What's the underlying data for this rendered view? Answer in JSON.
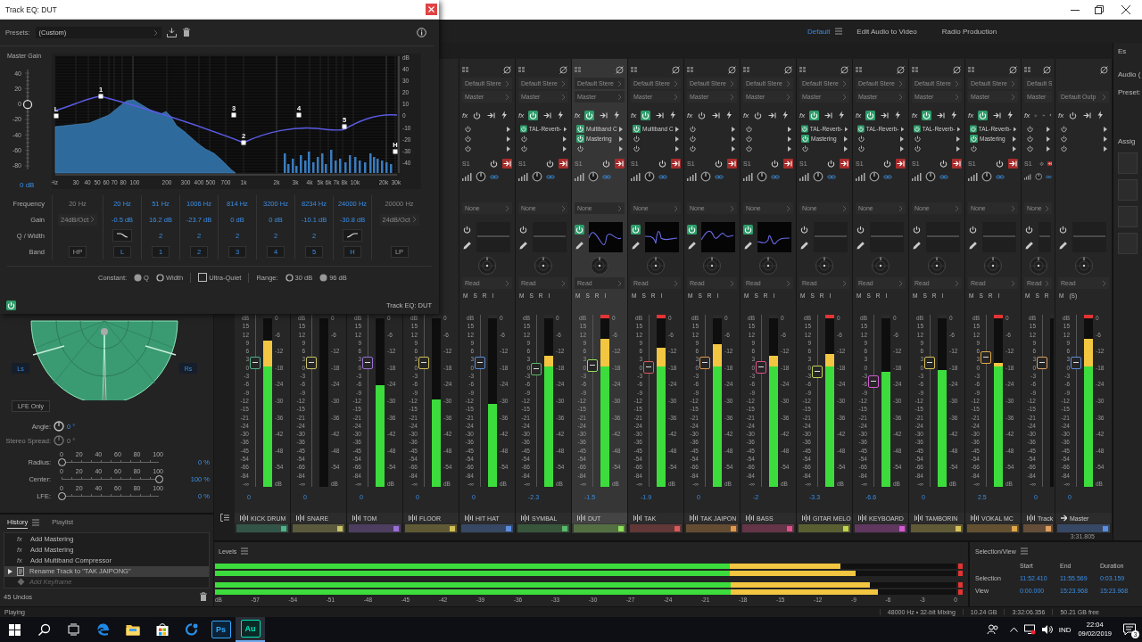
{
  "workspaces": [
    {
      "label": "Default",
      "selected": true
    },
    {
      "label": "Edit Audio to Video",
      "selected": false
    },
    {
      "label": "Radio Production",
      "selected": false
    }
  ],
  "eq_window": {
    "title": "Track EQ: DUT",
    "presets_label": "Presets:",
    "preset": "(Custom)",
    "master_gain": {
      "label": "Master Gain",
      "ticks": [
        "40",
        "20",
        "0",
        "-20",
        "-40",
        "-60",
        "-80"
      ],
      "level": 0.65,
      "reading": "0 dB"
    },
    "graph": {
      "db_ticks": [
        "dB",
        "40",
        "30",
        "20",
        "10",
        "0",
        "-10",
        "-20",
        "-30",
        "-40"
      ],
      "freq_ticks": [
        "Hz",
        "30",
        "40",
        "50",
        "60",
        "70",
        "80",
        "100",
        "200",
        "300",
        "400",
        "500",
        "700",
        "1k",
        "2k",
        "3k",
        "4k",
        "5k",
        "6k",
        "7k",
        "8k",
        "10k",
        "20k",
        "30k"
      ]
    },
    "row_labels": [
      "Frequency",
      "Gain",
      "Q / Width",
      "Band"
    ],
    "bands": [
      {
        "kind": "filter",
        "enabled": false,
        "frequency": "20 Hz",
        "slope": "24dB/Oct",
        "band": "HP"
      },
      {
        "kind": "low_shelf",
        "enabled": true,
        "frequency": "20 Hz",
        "gain": "-0.5 dB",
        "band": "L",
        "marker": "L"
      },
      {
        "kind": "peak",
        "enabled": true,
        "frequency": "51 Hz",
        "gain": "16.2 dB",
        "q": "2",
        "band": "1",
        "marker": "1"
      },
      {
        "kind": "peak",
        "enabled": true,
        "frequency": "1006 Hz",
        "gain": "-23.7 dB",
        "q": "2",
        "band": "2",
        "marker": "2"
      },
      {
        "kind": "peak",
        "enabled": true,
        "frequency": "814 Hz",
        "gain": "0 dB",
        "q": "2",
        "band": "3",
        "marker": "3"
      },
      {
        "kind": "peak",
        "enabled": true,
        "frequency": "3200 Hz",
        "gain": "0 dB",
        "q": "2",
        "band": "4",
        "marker": "4"
      },
      {
        "kind": "peak",
        "enabled": true,
        "frequency": "8234 Hz",
        "gain": "-10.1 dB",
        "q": "2",
        "band": "5",
        "marker": "5"
      },
      {
        "kind": "high_shelf",
        "enabled": true,
        "frequency": "24000 Hz",
        "gain": "-30.8 dB",
        "band": "H",
        "marker": "H"
      },
      {
        "kind": "filter",
        "enabled": false,
        "frequency": "20000 Hz",
        "slope": "24dB/Oct",
        "band": "LP"
      }
    ],
    "constant_label": "Constant:",
    "constant_options": [
      {
        "label": "Q",
        "selected": true
      },
      {
        "label": "Width",
        "selected": false
      }
    ],
    "ultra_quiet": {
      "label": "Ultra-Quiet",
      "checked": false
    },
    "range_label": "Range:",
    "range_options": [
      {
        "label": "30 dB",
        "selected": false
      },
      {
        "label": "96 dB",
        "selected": true
      }
    ],
    "power_on": true,
    "footer_title": "Track EQ: DUT"
  },
  "panner": {
    "left_label": "Ls",
    "right_label": "Rs",
    "lfe_button": "LFE Only",
    "knobs": [
      {
        "label": "Angle:",
        "reading": "0 °",
        "disabled": false
      },
      {
        "label": "Stereo Spread:",
        "reading": "0 °",
        "disabled": true
      }
    ],
    "sliders": [
      {
        "label": "Radius:",
        "ticks": [
          "0",
          "20",
          "40",
          "60",
          "80",
          "100"
        ],
        "level": 0,
        "reading": "0 %"
      },
      {
        "label": "Center:",
        "ticks": [
          "0",
          "20",
          "40",
          "60",
          "80",
          "100"
        ],
        "level": 1,
        "reading": "100 %"
      },
      {
        "label": "LFE:",
        "ticks": [
          "0",
          "20",
          "40",
          "60",
          "80",
          "100"
        ],
        "level": 0,
        "reading": "0 %"
      }
    ]
  },
  "history": {
    "tabs": [
      {
        "label": "History",
        "selected": true
      },
      {
        "label": "Playlist",
        "selected": false
      }
    ],
    "items": [
      {
        "kind": "effect",
        "icon_text": "fx",
        "text": "Add Mastering",
        "selected": false,
        "undone": false
      },
      {
        "kind": "effect",
        "icon_text": "fx",
        "text": "Add Mastering",
        "selected": false,
        "undone": false
      },
      {
        "kind": "effect",
        "icon_text": "fx",
        "text": "Add Multiband Compressor",
        "selected": false,
        "undone": false
      },
      {
        "kind": "rename",
        "text": "Rename Track to \"TAK JAIPONG\"",
        "selected": true,
        "undone": false
      },
      {
        "kind": "keyframe",
        "text": "Add Keyframe",
        "selected": false,
        "undone": true
      }
    ],
    "undos": "45 Undos"
  },
  "mixer": {
    "channels": [
      {
        "name": "KICK DRUM",
        "color": "#4fb38a",
        "selected": false,
        "fader": {
          "level": 0.74,
          "reading": "0"
        },
        "meter": {
          "level": 0.85,
          "clip": false
        },
        "fader_scale": [
          "dB",
          "15",
          "12",
          "9",
          "6",
          "3",
          "0",
          "-3",
          "-6",
          "-9",
          "-12",
          "-15",
          "-21",
          "-24",
          "-30",
          "-36",
          "-45",
          "-54",
          "-66",
          "-84",
          "-∞"
        ],
        "meter_scale": [
          "0",
          "-6",
          "-12",
          "-18",
          "-24",
          "-30",
          "-36",
          "-42",
          "-48",
          "-54",
          "dB"
        ]
      },
      {
        "name": "SNARE",
        "color": "#c9c46a",
        "selected": false,
        "fader": {
          "level": 0.74,
          "reading": "0"
        },
        "meter": {
          "level": 0,
          "clip": false
        },
        "fader_scale": [
          "dB",
          "15",
          "12",
          "9",
          "6",
          "3",
          "0",
          "-3",
          "-6",
          "-9",
          "-12",
          "-15",
          "-21",
          "-24",
          "-30",
          "-36",
          "-45",
          "-54",
          "-66",
          "-84",
          "-∞"
        ],
        "meter_scale": [
          "0",
          "-6",
          "-12",
          "-18",
          "-24",
          "-30",
          "-36",
          "-42",
          "-48",
          "-54",
          "dB"
        ]
      },
      {
        "name": "TOM",
        "color": "#9b6fd6",
        "selected": false,
        "fader": {
          "level": 0.74,
          "reading": "0"
        },
        "meter": {
          "level": 0.59,
          "clip": false
        },
        "fader_scale": [
          "dB",
          "15",
          "12",
          "9",
          "6",
          "3",
          "0",
          "-3",
          "-6",
          "-9",
          "-12",
          "-15",
          "-21",
          "-24",
          "-30",
          "-36",
          "-45",
          "-54",
          "-66",
          "-84",
          "-∞"
        ],
        "meter_scale": [
          "0",
          "-6",
          "-12",
          "-18",
          "-24",
          "-30",
          "-36",
          "-42",
          "-48",
          "-54",
          "dB"
        ]
      },
      {
        "name": "FLOOR",
        "color": "#d2bf55",
        "selected": false,
        "fader": {
          "level": 0.74,
          "reading": "0"
        },
        "meter": {
          "level": 0.51,
          "clip": false
        },
        "fader_scale": [
          "dB",
          "15",
          "12",
          "9",
          "6",
          "3",
          "0",
          "-3",
          "-6",
          "-9",
          "-12",
          "-15",
          "-21",
          "-24",
          "-30",
          "-36",
          "-45",
          "-54",
          "-66",
          "-84",
          "-∞"
        ],
        "meter_scale": [
          "0",
          "-6",
          "-12",
          "-18",
          "-24",
          "-30",
          "-36",
          "-42",
          "-48",
          "-54",
          "dB"
        ]
      },
      {
        "name": "HIT HAT",
        "color": "#5b8ee0",
        "selected": false,
        "fader": {
          "level": 0.74,
          "reading": "0"
        },
        "meter": {
          "level": 0.48,
          "clip": false
        },
        "fader_scale": [
          "dB",
          "15",
          "12",
          "9",
          "6",
          "3",
          "0",
          "-3",
          "-6",
          "-9",
          "-12",
          "-15",
          "-21",
          "-24",
          "-30",
          "-36",
          "-45",
          "-54",
          "-66",
          "-84",
          "-∞"
        ],
        "meter_scale": [
          "0",
          "-6",
          "-12",
          "-18",
          "-24",
          "-30",
          "-36",
          "-42",
          "-48",
          "-54",
          "dB"
        ],
        "strip": {
          "input": "Default Stere",
          "output": "Master",
          "fx_label": "fx",
          "fx_on": false,
          "inserts": [
            {
              "on": false
            },
            {
              "on": false
            },
            {
              "on": false
            }
          ],
          "send": "S1",
          "bus": "None",
          "eq_on": false,
          "automation": "Read",
          "msr": [
            "M",
            "S",
            "R",
            "I"
          ]
        }
      },
      {
        "name": "SYMBAL",
        "color": "#59b86a",
        "selected": false,
        "fader": {
          "level": 0.7,
          "reading": "-2.3"
        },
        "meter": {
          "level": 0.76,
          "clip": false
        },
        "fader_scale": [
          "dB",
          "15",
          "12",
          "9",
          "6",
          "3",
          "0",
          "-3",
          "-6",
          "-9",
          "-12",
          "-15",
          "-21",
          "-24",
          "-30",
          "-36",
          "-45",
          "-54",
          "-66",
          "-84",
          "-∞"
        ],
        "meter_scale": [
          "0",
          "-6",
          "-12",
          "-18",
          "-24",
          "-30",
          "-36",
          "-42",
          "-48",
          "-54",
          "dB"
        ],
        "strip": {
          "input": "Default Stere",
          "output": "Master",
          "fx_label": "fx",
          "fx_on": true,
          "inserts": [
            {
              "name": "TAL-Reverb-",
              "on": true
            },
            {
              "on": false
            },
            {
              "on": false
            }
          ],
          "send": "S1",
          "bus": "None",
          "eq_on": false,
          "automation": "Read",
          "msr": [
            "M",
            "S",
            "R",
            "I"
          ]
        }
      },
      {
        "name": "DUT",
        "color": "#8fe05a",
        "selected": true,
        "fader": {
          "level": 0.72,
          "reading": "-1.5"
        },
        "meter": {
          "level": 0.86,
          "clip": true
        },
        "fader_scale": [
          "dB",
          "15",
          "12",
          "9",
          "6",
          "3",
          "0",
          "-3",
          "-6",
          "-9",
          "-12",
          "-15",
          "-21",
          "-24",
          "-30",
          "-36",
          "-45",
          "-54",
          "-66",
          "-84",
          "-∞"
        ],
        "meter_scale": [
          "0",
          "-6",
          "-12",
          "-18",
          "-24",
          "-30",
          "-36",
          "-42",
          "-48",
          "-54",
          "dB"
        ],
        "strip": {
          "input": "Default Stere",
          "output": "Master",
          "fx_label": "fx",
          "fx_on": true,
          "inserts": [
            {
              "name": "Multiband C",
              "on": true
            },
            {
              "name": "Mastering",
              "on": true
            },
            {
              "on": false
            }
          ],
          "send": "S1",
          "bus": "None",
          "eq_on": true,
          "automation": "Read",
          "msr": [
            "M",
            "S",
            "R",
            "I"
          ]
        }
      },
      {
        "name": "TAK",
        "color": "#d85a5a",
        "selected": false,
        "fader": {
          "level": 0.71,
          "reading": "-1.9"
        },
        "meter": {
          "level": 0.81,
          "clip": true
        },
        "fader_scale": [
          "dB",
          "15",
          "12",
          "9",
          "6",
          "3",
          "0",
          "-3",
          "-6",
          "-9",
          "-12",
          "-15",
          "-21",
          "-24",
          "-30",
          "-36",
          "-45",
          "-54",
          "-66",
          "-84",
          "-∞"
        ],
        "meter_scale": [
          "0",
          "-6",
          "-12",
          "-18",
          "-24",
          "-30",
          "-36",
          "-42",
          "-48",
          "-54",
          "dB"
        ],
        "strip": {
          "input": "Default Stere",
          "output": "Master",
          "fx_label": "fx",
          "fx_on": true,
          "inserts": [
            {
              "name": "Multiband C",
              "on": true
            },
            {
              "on": false
            },
            {
              "on": false
            }
          ],
          "send": "S1",
          "bus": "None",
          "eq_on": true,
          "automation": "Read",
          "msr": [
            "M",
            "S",
            "R",
            "I"
          ]
        }
      },
      {
        "name": "TAK JAIPON",
        "color": "#e09a4a",
        "selected": false,
        "fader": {
          "level": 0.74,
          "reading": "0"
        },
        "meter": {
          "level": 0.83,
          "clip": false
        },
        "fader_scale": [
          "dB",
          "15",
          "12",
          "9",
          "6",
          "3",
          "0",
          "-3",
          "-6",
          "-9",
          "-12",
          "-15",
          "-21",
          "-24",
          "-30",
          "-36",
          "-45",
          "-54",
          "-66",
          "-84",
          "-∞"
        ],
        "meter_scale": [
          "0",
          "-6",
          "-12",
          "-18",
          "-24",
          "-30",
          "-36",
          "-42",
          "-48",
          "-54",
          "dB"
        ],
        "strip": {
          "input": "Default Stere",
          "output": "Master",
          "fx_label": "fx",
          "fx_on": false,
          "inserts": [
            {
              "on": false
            },
            {
              "on": false
            },
            {
              "on": false
            }
          ],
          "send": "S1",
          "bus": "None",
          "eq_on": true,
          "automation": "Read",
          "msr": [
            "M",
            "S",
            "R",
            "I"
          ]
        }
      },
      {
        "name": "BASS",
        "color": "#e0508a",
        "selected": false,
        "fader": {
          "level": 0.71,
          "reading": "-2"
        },
        "meter": {
          "level": 0.76,
          "clip": false
        },
        "fader_scale": [
          "dB",
          "15",
          "12",
          "9",
          "6",
          "3",
          "0",
          "-3",
          "-6",
          "-9",
          "-12",
          "-15",
          "-21",
          "-24",
          "-30",
          "-36",
          "-45",
          "-54",
          "-66",
          "-84",
          "-∞"
        ],
        "meter_scale": [
          "0",
          "-6",
          "-12",
          "-18",
          "-24",
          "-30",
          "-36",
          "-42",
          "-48",
          "-54",
          "dB"
        ],
        "strip": {
          "input": "Default Stere",
          "output": "Master",
          "fx_label": "fx",
          "fx_on": false,
          "inserts": [
            {
              "on": false
            },
            {
              "on": false
            },
            {
              "on": false
            }
          ],
          "send": "S1",
          "bus": "None",
          "eq_on": true,
          "automation": "Read",
          "msr": [
            "M",
            "S",
            "R",
            "I"
          ]
        }
      },
      {
        "name": "GITAR MELO",
        "color": "#c2d34a",
        "selected": false,
        "fader": {
          "level": 0.68,
          "reading": "-3.3"
        },
        "meter": {
          "level": 0.77,
          "clip": true
        },
        "fader_scale": [
          "dB",
          "15",
          "12",
          "9",
          "6",
          "3",
          "0",
          "-3",
          "-6",
          "-9",
          "-12",
          "-15",
          "-21",
          "-24",
          "-30",
          "-36",
          "-45",
          "-54",
          "-66",
          "-84",
          "-∞"
        ],
        "meter_scale": [
          "0",
          "-6",
          "-12",
          "-18",
          "-24",
          "-30",
          "-36",
          "-42",
          "-48",
          "-54",
          "dB"
        ],
        "strip": {
          "input": "Default Stere",
          "output": "Master",
          "fx_label": "fx",
          "fx_on": true,
          "inserts": [
            {
              "name": "TAL-Reverb-",
              "on": true
            },
            {
              "name": "Mastering",
              "on": true
            },
            {
              "on": false
            }
          ],
          "send": "S1",
          "bus": "None",
          "eq_on": false,
          "automation": "Read",
          "msr": [
            "M",
            "S",
            "R",
            "I"
          ]
        }
      },
      {
        "name": "KEYBOARD",
        "color": "#d35ad3",
        "selected": false,
        "fader": {
          "level": 0.62,
          "reading": "-6.6"
        },
        "meter": {
          "level": 0.67,
          "clip": false
        },
        "fader_scale": [
          "dB",
          "15",
          "12",
          "9",
          "6",
          "3",
          "0",
          "-3",
          "-6",
          "-9",
          "-12",
          "-15",
          "-21",
          "-24",
          "-30",
          "-36",
          "-45",
          "-54",
          "-66",
          "-84",
          "-∞"
        ],
        "meter_scale": [
          "0",
          "-6",
          "-12",
          "-18",
          "-24",
          "-30",
          "-36",
          "-42",
          "-48",
          "-54",
          "dB"
        ],
        "strip": {
          "input": "Default Stere",
          "output": "Master",
          "fx_label": "fx",
          "fx_on": true,
          "inserts": [
            {
              "name": "TAL-Reverb-",
              "on": true
            },
            {
              "on": false
            },
            {
              "on": false
            }
          ],
          "send": "S1",
          "bus": "None",
          "eq_on": false,
          "automation": "Read",
          "msr": [
            "M",
            "S",
            "R",
            "I"
          ]
        }
      },
      {
        "name": "TAMBORIN",
        "color": "#d8c25a",
        "selected": false,
        "fader": {
          "level": 0.74,
          "reading": "0"
        },
        "meter": {
          "level": 0.68,
          "clip": false
        },
        "fader_scale": [
          "dB",
          "15",
          "12",
          "9",
          "6",
          "3",
          "0",
          "-3",
          "-6",
          "-9",
          "-12",
          "-15",
          "-21",
          "-24",
          "-30",
          "-36",
          "-45",
          "-54",
          "-66",
          "-84",
          "-∞"
        ],
        "meter_scale": [
          "0",
          "-6",
          "-12",
          "-18",
          "-24",
          "-30",
          "-36",
          "-42",
          "-48",
          "-54",
          "dB"
        ],
        "strip": {
          "input": "Default Stere",
          "output": "Master",
          "fx_label": "fx",
          "fx_on": true,
          "inserts": [
            {
              "name": "TAL-Reverb-",
              "on": true
            },
            {
              "on": false
            },
            {
              "on": false
            }
          ],
          "send": "S1",
          "bus": "None",
          "eq_on": false,
          "automation": "Read",
          "msr": [
            "M",
            "S",
            "R",
            "I"
          ]
        }
      },
      {
        "name": "VOKAL MC",
        "color": "#e0a84a",
        "selected": false,
        "fader": {
          "level": 0.77,
          "reading": "2.5"
        },
        "meter": {
          "level": 0.72,
          "clip": true
        },
        "fader_scale": [
          "dB",
          "15",
          "12",
          "9",
          "6",
          "3",
          "0",
          "-3",
          "-6",
          "-9",
          "-12",
          "-15",
          "-21",
          "-24",
          "-30",
          "-36",
          "-45",
          "-54",
          "-66",
          "-84",
          "-∞"
        ],
        "meter_scale": [
          "0",
          "-6",
          "-12",
          "-18",
          "-24",
          "-30",
          "-36",
          "-42",
          "-48",
          "-54",
          "dB"
        ],
        "strip": {
          "input": "Default Stere",
          "output": "Master",
          "fx_label": "fx",
          "fx_on": true,
          "inserts": [
            {
              "name": "TAL-Reverb-",
              "on": true
            },
            {
              "name": "Mastering",
              "on": true
            },
            {
              "on": false
            }
          ],
          "send": "S1",
          "bus": "None",
          "eq_on": false,
          "automation": "Read",
          "msr": [
            "M",
            "S",
            "R",
            "I"
          ]
        }
      },
      {
        "name": "Track",
        "color": "#e0a060",
        "selected": false,
        "fader": {
          "level": 0.74,
          "reading": "0"
        },
        "meter": {
          "level": 0,
          "clip": false
        },
        "fader_scale": [
          "dB",
          "15",
          "12",
          "9",
          "6",
          "3",
          "0",
          "-3",
          "-6",
          "-9",
          "-12",
          "-15",
          "-21",
          "-24",
          "-30",
          "-36",
          "-45",
          "-54",
          "-66",
          "-84",
          "-∞"
        ],
        "strip": {
          "input": "Default S",
          "output": "Master",
          "fx_label": "fx",
          "fx_on": false,
          "inserts": [
            {
              "on": false
            },
            {
              "on": false
            },
            {
              "on": false
            }
          ],
          "send": "S1",
          "bus": "None",
          "eq_on": false,
          "automation": "Read",
          "msr": [
            "M",
            "S",
            "R"
          ]
        }
      }
    ],
    "master": {
      "name": "Master",
      "color": "#5b8ee0",
      "selected": false,
      "fader": {
        "level": 0.74,
        "reading": "0"
      },
      "meter": {
        "level": 0.86,
        "clip": true
      },
      "fader_scale": [
        "dB",
        "15",
        "12",
        "9",
        "6",
        "3",
        "0",
        "-3",
        "-6",
        "-9",
        "-12",
        "-15",
        "-21",
        "-24",
        "-30",
        "-36",
        "-45",
        "-54",
        "-66",
        "-84",
        "-∞"
      ],
      "meter_scale": [
        "0",
        "-6",
        "-12",
        "-18",
        "-24",
        "-30",
        "-36",
        "-42",
        "-48",
        "-54",
        "dB"
      ],
      "strip": {
        "output": "Default Outp",
        "fx_label": "fx",
        "fx_on": false,
        "inserts": [
          {
            "on": false
          },
          {
            "on": false
          },
          {
            "on": false
          }
        ],
        "eq_on": false,
        "automation": "Read",
        "msr": [
          "M",
          "(S)"
        ]
      }
    },
    "time": "3:31.805"
  },
  "right_dock": {
    "labels": [
      "Es",
      "Audio (",
      "Preset:",
      "Assig"
    ]
  },
  "levels": {
    "title": "Levels",
    "bars": [
      {
        "level": 0.85,
        "clip": true
      },
      {
        "level": 0.87,
        "clip": true
      },
      {
        "level": 0.89,
        "clip": true
      },
      {
        "level": 0.9,
        "clip": true
      }
    ],
    "scale": [
      "dB",
      "-57",
      "-54",
      "-51",
      "-48",
      "-45",
      "-42",
      "-39",
      "-36",
      "-33",
      "-30",
      "-27",
      "-24",
      "-21",
      "-18",
      "-15",
      "-12",
      "-9",
      "-6",
      "-3",
      "0"
    ]
  },
  "selection_view": {
    "title": "Selection/View",
    "columns": [
      "Start",
      "End",
      "Duration"
    ],
    "rows": [
      {
        "label": "Selection",
        "values": [
          "11:52.410",
          "11:55.569",
          "0:03.159"
        ]
      },
      {
        "label": "View",
        "values": [
          "0:00.000",
          "15:23.968",
          "15:23.968"
        ]
      }
    ]
  },
  "status_bar": {
    "state": "Playing",
    "items": [
      "48000 Hz • 32-bit Mixing",
      "10.24 GB",
      "3:32:06.356",
      "50.21 GB free"
    ]
  },
  "taskbar": {
    "apps": [
      {
        "kind": "edge",
        "selected": false
      },
      {
        "kind": "explorer",
        "selected": false
      },
      {
        "kind": "store",
        "selected": false
      },
      {
        "kind": "sync",
        "selected": false
      },
      {
        "kind": "ps",
        "label": "Ps",
        "selected": false
      },
      {
        "kind": "au",
        "label": "Au",
        "selected": true
      }
    ],
    "language": "IND",
    "time": "22:04",
    "date": "09/02/2019",
    "notifications": "3"
  }
}
